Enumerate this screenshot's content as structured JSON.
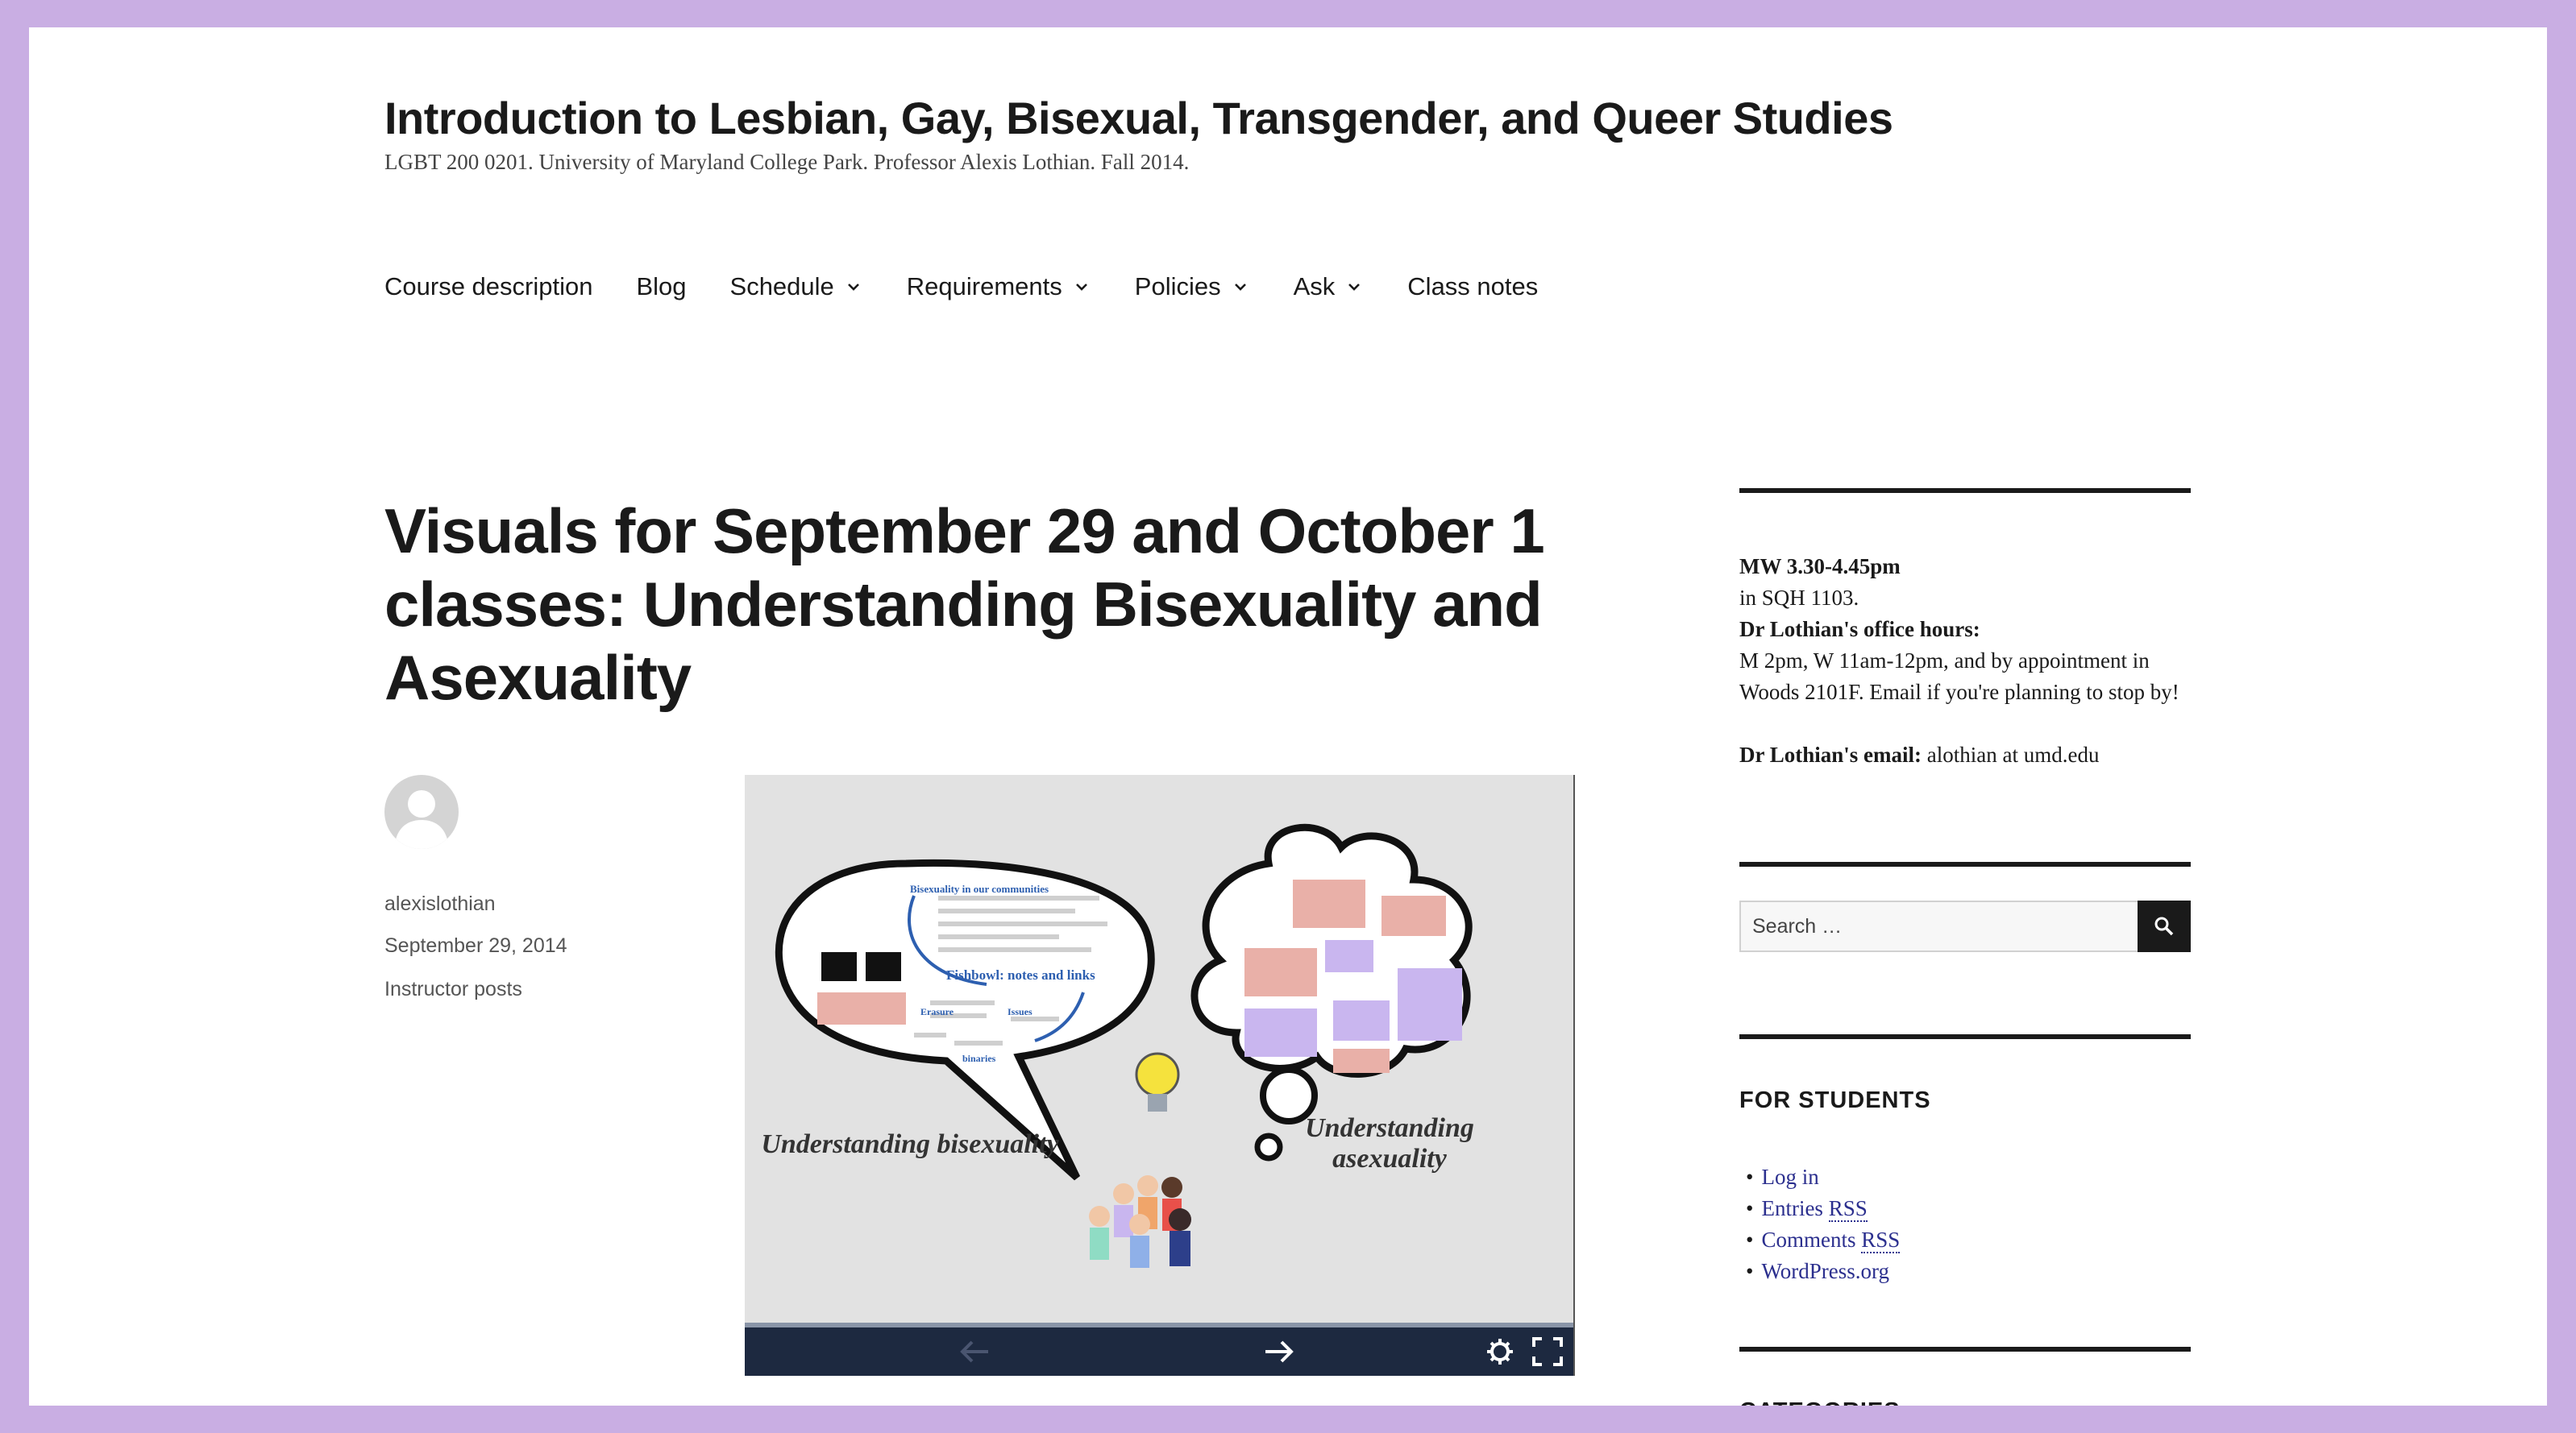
{
  "site": {
    "title": "Introduction to Lesbian, Gay, Bisexual, Transgender, and Queer Studies",
    "description": "LGBT 200 0201. University of Maryland College Park. Professor Alexis Lothian. Fall 2014."
  },
  "nav": {
    "items": [
      {
        "label": "Course description",
        "dropdown": false
      },
      {
        "label": "Blog",
        "dropdown": false
      },
      {
        "label": "Schedule",
        "dropdown": true
      },
      {
        "label": "Requirements",
        "dropdown": true
      },
      {
        "label": "Policies",
        "dropdown": true
      },
      {
        "label": "Ask",
        "dropdown": true
      },
      {
        "label": "Class notes",
        "dropdown": false
      }
    ]
  },
  "entry": {
    "title": "Visuals for September 29 and October 1 classes: Understanding Bisexuality and Asexuality",
    "author": "alexislothian",
    "date": "September 29, 2014",
    "category": "Instructor posts"
  },
  "presentation": {
    "caption_left": "Understanding bisexuality",
    "caption_right": "Understanding asexuality",
    "bubble_heading": "Bisexuality in our communities",
    "bubble_fishbowl": "Fishbowl: notes and links",
    "bubble_words": [
      "Erasure",
      "Issues",
      "binaries"
    ]
  },
  "sidebar": {
    "hours": {
      "time": "MW 3.30-4.45pm",
      "room": "in SQH 1103.",
      "office_label": "Dr Lothian's office hours:",
      "office_text": "M 2pm, W 11am-12pm, and by appointment in Woods 2101F. Email if you're planning to stop by!",
      "email_label": "Dr Lothian's email:",
      "email_text": " alothian at umd.edu"
    },
    "search": {
      "placeholder": "Search …"
    },
    "for_students": {
      "title": "FOR STUDENTS",
      "log_in": "Log in",
      "entries_prefix": "Entries",
      "comments_prefix": "Comments",
      "rss": "RSS",
      "wordpress": "WordPress.org"
    },
    "categories": {
      "title": "CATEGORIES"
    }
  },
  "colors": {
    "frame": "#c9aee3",
    "link": "#2b2f8e",
    "prezi_bar": "#1d2940"
  }
}
